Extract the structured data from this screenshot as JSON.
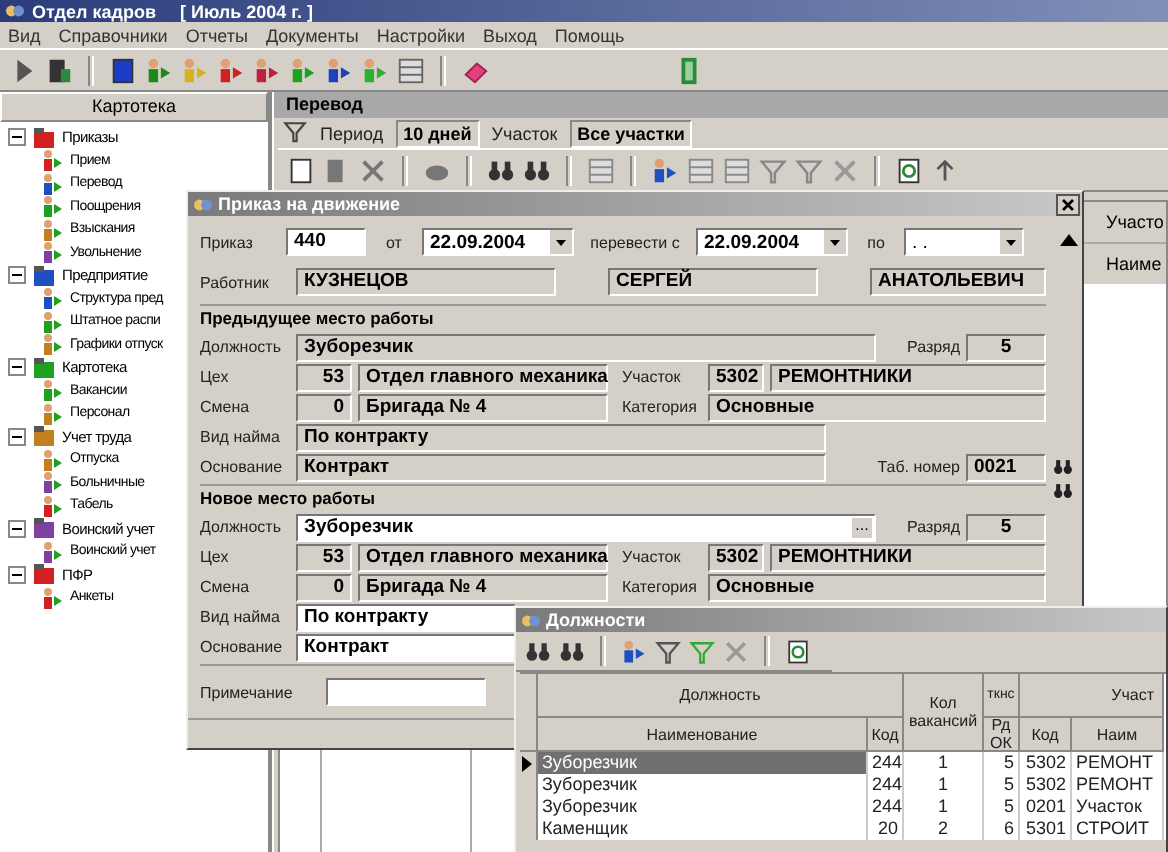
{
  "window": {
    "title": "Отдел кадров",
    "period": "[ Июль 2004 г. ]"
  },
  "menu": [
    "Вид",
    "Справочники",
    "Отчеты",
    "Документы",
    "Настройки",
    "Выход",
    "Помощь"
  ],
  "sidebar": {
    "title": "Картотека",
    "items": [
      {
        "label": "Приказы",
        "expanded": true,
        "children": [
          {
            "label": "Прием"
          },
          {
            "label": "Перевод"
          },
          {
            "label": "Поощрения"
          },
          {
            "label": "Взыскания"
          },
          {
            "label": "Увольнение"
          }
        ]
      },
      {
        "label": "Предприятие",
        "expanded": true,
        "children": [
          {
            "label": "Структура пред"
          },
          {
            "label": "Штатное распи"
          },
          {
            "label": "Графики отпуск"
          }
        ]
      },
      {
        "label": "Картотека",
        "expanded": true,
        "children": [
          {
            "label": "Вакансии"
          },
          {
            "label": "Персонал"
          }
        ]
      },
      {
        "label": "Учет труда",
        "expanded": true,
        "children": [
          {
            "label": "Отпуска"
          },
          {
            "label": "Больничные"
          },
          {
            "label": "Табель"
          }
        ]
      },
      {
        "label": "Воинский учет",
        "expanded": true,
        "children": [
          {
            "label": "Воинский учет"
          }
        ]
      },
      {
        "label": "ПФР",
        "expanded": true,
        "children": [
          {
            "label": "Анкеты"
          }
        ]
      }
    ]
  },
  "panel": {
    "title": "Перевод",
    "period_label": "Период",
    "period": "10 дней",
    "area_label": "Участок",
    "area": "Все участки",
    "columns": [
      "Участо",
      "Наиме"
    ]
  },
  "dialog": {
    "title": "Приказ на движение",
    "order": {
      "label": "Приказ",
      "value": "440",
      "date_label": "от",
      "date": "22.09.2004",
      "from_label": "перевести с",
      "from": "22.09.2004",
      "to_label": "по",
      "to": ". ."
    },
    "employee": {
      "label": "Работник",
      "last_name": "КУЗНЕЦОВ",
      "first_name": "СЕРГЕЙ",
      "patronymic": "АНАТОЛЬЕВИЧ"
    },
    "sections": [
      {
        "title": "Предыдущее место работы",
        "position": {
          "label": "Должность",
          "value": "Зуборезчик",
          "editable": false
        },
        "grade": {
          "label": "Разряд",
          "value": "5"
        },
        "shop": {
          "label": "Цех",
          "code": "53",
          "name": "Отдел главного механика"
        },
        "area": {
          "label": "Участок",
          "code": "5302",
          "name": "РЕМОНТНИКИ"
        },
        "shift": {
          "label": "Смена",
          "code": "0",
          "name": "Бригада № 4"
        },
        "category": {
          "label": "Категория",
          "value": "Основные"
        },
        "hire": {
          "label": "Вид найма",
          "value": "По контракту",
          "editable": false
        },
        "basis": {
          "label": "Основание",
          "value": "Контракт",
          "editable": false
        },
        "tab_number": {
          "label": "Таб. номер",
          "value": "0021"
        }
      },
      {
        "title": "Новое место работы",
        "position": {
          "label": "Должность",
          "value": "Зуборезчик",
          "editable": true
        },
        "grade": {
          "label": "Разряд",
          "value": "5"
        },
        "shop": {
          "label": "Цех",
          "code": "53",
          "name": "Отдел главного механика"
        },
        "area": {
          "label": "Участок",
          "code": "5302",
          "name": "РЕМОНТНИКИ"
        },
        "shift": {
          "label": "Смена",
          "code": "0",
          "name": "Бригада № 4"
        },
        "category": {
          "label": "Категория",
          "value": "Основные"
        },
        "hire": {
          "label": "Вид найма",
          "value": "По контракту",
          "editable": true
        },
        "basis": {
          "label": "Основание",
          "value": "Контракт",
          "editable": true
        }
      }
    ],
    "note": {
      "label": "Примечание"
    },
    "picker": "..."
  },
  "positions": {
    "title": "Должности",
    "header": {
      "group": "Должность",
      "name": "Наименование",
      "code": "Код",
      "vacancies": "Кол вакансий",
      "grade_group": "ткнс",
      "grade": "Рд ОК",
      "area_group": "Участ",
      "area_code": "Код",
      "area_name": "Наим"
    },
    "rows": [
      {
        "name": "Зуборезчик",
        "code": "244",
        "vacancies": "1",
        "grade": "5",
        "area_code": "5302",
        "area_name": "РЕМОНТ",
        "selected": true
      },
      {
        "name": "Зуборезчик",
        "code": "244",
        "vacancies": "1",
        "grade": "5",
        "area_code": "5302",
        "area_name": "РЕМОНТ",
        "selected": false
      },
      {
        "name": "Зуборезчик",
        "code": "244",
        "vacancies": "1",
        "grade": "5",
        "area_code": "0201",
        "area_name": "Участок",
        "selected": false
      },
      {
        "name": "Каменщик",
        "code": "20",
        "vacancies": "2",
        "grade": "6",
        "area_code": "5301",
        "area_name": "СТРОИТ",
        "selected": false
      }
    ]
  }
}
